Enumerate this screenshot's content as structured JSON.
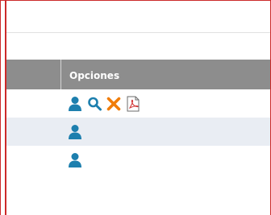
{
  "table": {
    "header": {
      "options_label": "Opciones"
    },
    "rows": [
      {
        "actions": [
          "user-icon",
          "search-icon",
          "delete-icon",
          "pdf-icon"
        ]
      },
      {
        "actions": [
          "user-icon"
        ]
      },
      {
        "actions": [
          "user-icon"
        ]
      }
    ]
  },
  "colors": {
    "header_bg": "#8d8d8d",
    "alt_row_bg": "#e9edf3",
    "user_icon": "#1d7fae",
    "search_icon": "#1d7fae",
    "delete_icon": "#f07d0a",
    "pdf_icon": "#d23a3a",
    "frame_border": "#cc2a2a"
  }
}
